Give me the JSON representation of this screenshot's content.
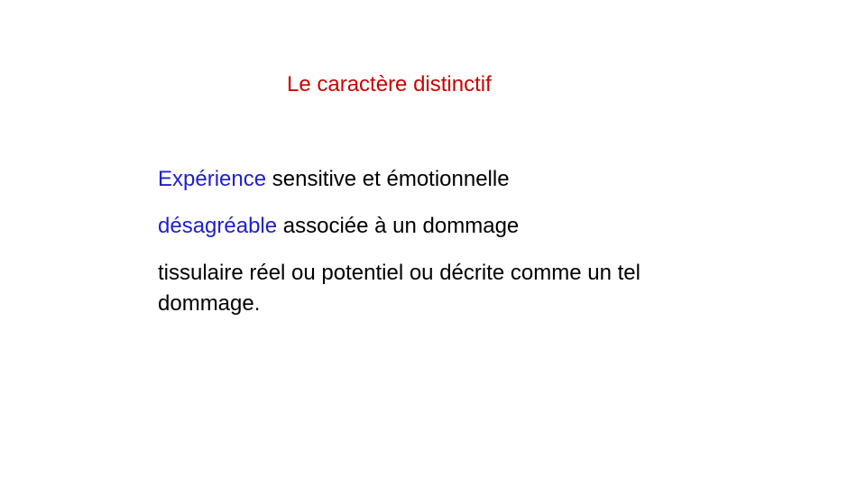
{
  "slide": {
    "title": "Le caractère distinctif",
    "title_color": "#cc0000",
    "accent_color": "#1f1fcc",
    "line1": {
      "highlight": "Expérience",
      "rest": " sensitive et émotionnelle"
    },
    "line2": {
      "highlight": "désagréable",
      "rest": " associée à un dommage"
    },
    "line3": "tissulaire réel ou potentiel ou décrite comme un tel dommage."
  }
}
